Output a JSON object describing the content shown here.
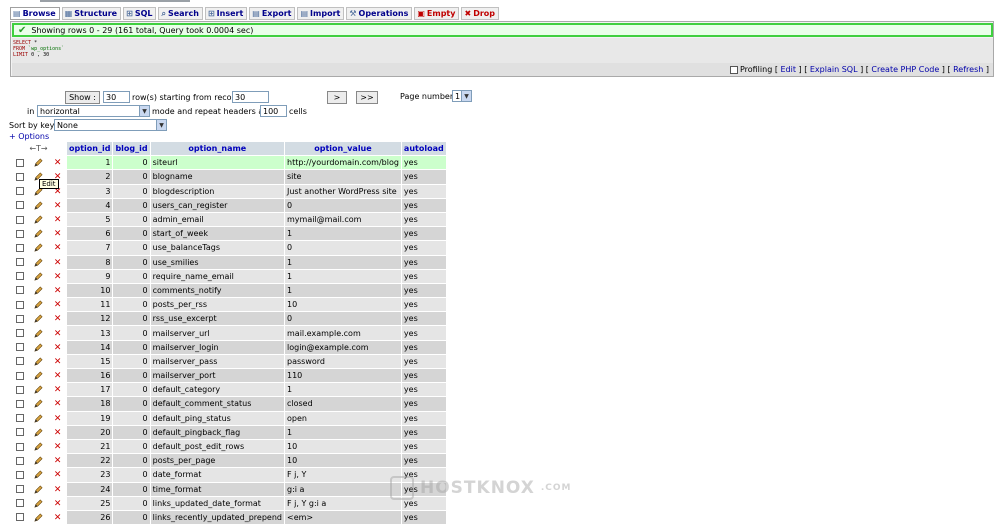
{
  "tabs": [
    {
      "label": "Browse",
      "icon": "browse-icon",
      "active": true,
      "danger": false
    },
    {
      "label": "Structure",
      "icon": "structure-icon",
      "active": false,
      "danger": false
    },
    {
      "label": "SQL",
      "icon": "sql-icon",
      "active": false,
      "danger": false
    },
    {
      "label": "Search",
      "icon": "search-icon",
      "active": false,
      "danger": false
    },
    {
      "label": "Insert",
      "icon": "insert-icon",
      "active": false,
      "danger": false
    },
    {
      "label": "Export",
      "icon": "export-icon",
      "active": false,
      "danger": false
    },
    {
      "label": "Import",
      "icon": "import-icon",
      "active": false,
      "danger": false
    },
    {
      "label": "Operations",
      "icon": "operations-icon",
      "active": false,
      "danger": false
    },
    {
      "label": "Empty",
      "icon": "empty-icon",
      "active": false,
      "danger": true
    },
    {
      "label": "Drop",
      "icon": "drop-icon",
      "active": false,
      "danger": true
    }
  ],
  "query": {
    "message": "Showing rows 0 - 29 (161 total, Query took 0.0004 sec)",
    "sql_line1_kw": "SELECT",
    "sql_line1_rest": " *",
    "sql_line2_kw": "FROM",
    "sql_line2_rest": " `wp_options`",
    "sql_line3_kw": "LIMIT",
    "sql_line3_rest": " 0 , 30",
    "links": {
      "profiling": "Profiling",
      "edit": "Edit",
      "explain": "Explain SQL",
      "php": "Create PHP Code",
      "refresh": "Refresh"
    }
  },
  "nav": {
    "show_label": "Show :",
    "rows_value": "30",
    "rows_text": "row(s) starting from record #",
    "start_value": "30",
    "next": ">",
    "last": ">>",
    "page_label": "Page number:",
    "page_value": "1",
    "in_label": "in",
    "mode_value": "horizontal",
    "mode_text": "mode and repeat headers after",
    "repeat_value": "100",
    "cells_text": "cells",
    "sort_label": "Sort by key:",
    "sort_value": "None",
    "options_label": "+ Options"
  },
  "table": {
    "nav_arrows": "←T→",
    "headers": [
      "option_id",
      "blog_id",
      "option_name",
      "option_value",
      "autoload"
    ],
    "tooltip": "Edit",
    "rows": [
      {
        "id": "1",
        "blog": "0",
        "name": "siteurl",
        "value": "http://yourdomain.com/blog",
        "auto": "yes"
      },
      {
        "id": "2",
        "blog": "0",
        "name": "blogname",
        "value": "site",
        "auto": "yes"
      },
      {
        "id": "3",
        "blog": "0",
        "name": "blogdescription",
        "value": "Just another WordPress site",
        "auto": "yes"
      },
      {
        "id": "4",
        "blog": "0",
        "name": "users_can_register",
        "value": "0",
        "auto": "yes"
      },
      {
        "id": "5",
        "blog": "0",
        "name": "admin_email",
        "value": "mymail@mail.com",
        "auto": "yes"
      },
      {
        "id": "6",
        "blog": "0",
        "name": "start_of_week",
        "value": "1",
        "auto": "yes"
      },
      {
        "id": "7",
        "blog": "0",
        "name": "use_balanceTags",
        "value": "0",
        "auto": "yes"
      },
      {
        "id": "8",
        "blog": "0",
        "name": "use_smilies",
        "value": "1",
        "auto": "yes"
      },
      {
        "id": "9",
        "blog": "0",
        "name": "require_name_email",
        "value": "1",
        "auto": "yes"
      },
      {
        "id": "10",
        "blog": "0",
        "name": "comments_notify",
        "value": "1",
        "auto": "yes"
      },
      {
        "id": "11",
        "blog": "0",
        "name": "posts_per_rss",
        "value": "10",
        "auto": "yes"
      },
      {
        "id": "12",
        "blog": "0",
        "name": "rss_use_excerpt",
        "value": "0",
        "auto": "yes"
      },
      {
        "id": "13",
        "blog": "0",
        "name": "mailserver_url",
        "value": "mail.example.com",
        "auto": "yes"
      },
      {
        "id": "14",
        "blog": "0",
        "name": "mailserver_login",
        "value": "login@example.com",
        "auto": "yes"
      },
      {
        "id": "15",
        "blog": "0",
        "name": "mailserver_pass",
        "value": "password",
        "auto": "yes"
      },
      {
        "id": "16",
        "blog": "0",
        "name": "mailserver_port",
        "value": "110",
        "auto": "yes"
      },
      {
        "id": "17",
        "blog": "0",
        "name": "default_category",
        "value": "1",
        "auto": "yes"
      },
      {
        "id": "18",
        "blog": "0",
        "name": "default_comment_status",
        "value": "closed",
        "auto": "yes"
      },
      {
        "id": "19",
        "blog": "0",
        "name": "default_ping_status",
        "value": "open",
        "auto": "yes"
      },
      {
        "id": "20",
        "blog": "0",
        "name": "default_pingback_flag",
        "value": "1",
        "auto": "yes"
      },
      {
        "id": "21",
        "blog": "0",
        "name": "default_post_edit_rows",
        "value": "10",
        "auto": "yes"
      },
      {
        "id": "22",
        "blog": "0",
        "name": "posts_per_page",
        "value": "10",
        "auto": "yes"
      },
      {
        "id": "23",
        "blog": "0",
        "name": "date_format",
        "value": "F j, Y",
        "auto": "yes"
      },
      {
        "id": "24",
        "blog": "0",
        "name": "time_format",
        "value": "g:i a",
        "auto": "yes"
      },
      {
        "id": "25",
        "blog": "0",
        "name": "links_updated_date_format",
        "value": "F j, Y g:i a",
        "auto": "yes"
      },
      {
        "id": "26",
        "blog": "0",
        "name": "links_recently_updated_prepend",
        "value": "<em>",
        "auto": "yes"
      }
    ]
  },
  "watermark": {
    "text": "HOSTKNOX",
    "suffix": ".COM"
  },
  "colors": {
    "header_bg": "#d3dce3",
    "row_highlight": "#ccffcc",
    "success_border": "#3fd03f",
    "link": "#0000aa"
  }
}
